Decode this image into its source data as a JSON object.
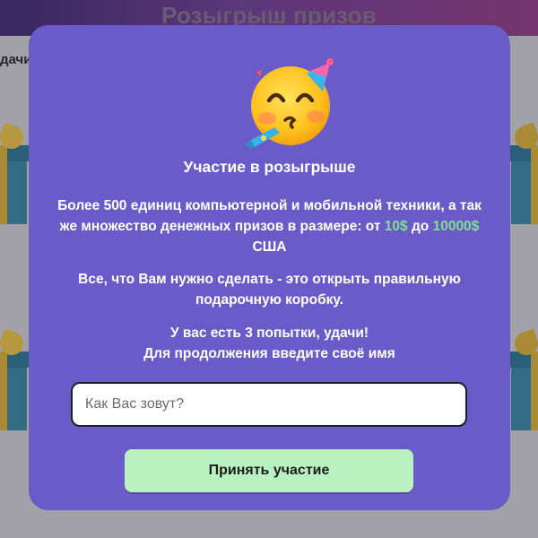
{
  "background": {
    "title": "Розыгрыш призов",
    "left_text": "дачи!"
  },
  "modal": {
    "emoji_icon": "partying-face-icon",
    "title": "Участие в розыгрыше",
    "p1": {
      "text_a": "Более 500 единиц компьютерной и мобильной техники, а так же множество денежных призов в размере: от ",
      "amount_from": "10$",
      "text_b": " до ",
      "amount_to": "10000$",
      "text_c": " США"
    },
    "p2": "Все, что Вам нужно сделать - это открыть правильную подарочную коробку.",
    "p3_line1": "У вас есть 3 попытки, удачи!",
    "p3_line2": "Для продолжения введите своё имя",
    "name_input": {
      "placeholder": "Как Вас зовут?",
      "value": ""
    },
    "submit_label": "Принять участие"
  },
  "colors": {
    "modal_bg": "#6b5bc9",
    "highlight": "#7fe08c",
    "button_bg": "#b9f2c1"
  }
}
